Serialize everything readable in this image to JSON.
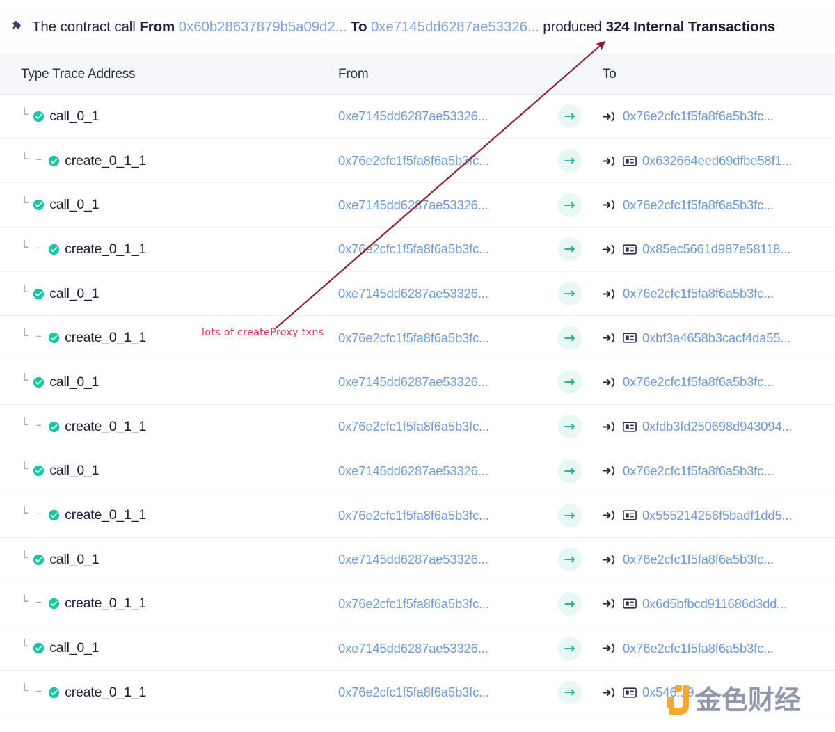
{
  "banner": {
    "icon": "puzzle-piece-icon",
    "prefix": "The contract call",
    "from_label": "From",
    "from_address": "0x60b28637879b5a09d2...",
    "to_label": "To",
    "to_address": "0xe7145dd6287ae53326...",
    "produced_word": "produced",
    "count": "324",
    "suffix": "Internal Transactions"
  },
  "table": {
    "columns": {
      "type": "Type Trace Address",
      "from": "From",
      "to": "To"
    },
    "rows": [
      {
        "level": 1,
        "tree": "└",
        "status": "success-check-icon",
        "type": "call_0_1",
        "from": "0xe7145dd6287ae53326...",
        "arrow": "arrow-right-icon",
        "to_icon": "sign-in-arrow-icon",
        "contract": false,
        "to": "0x76e2cfc1f5fa8f6a5b3fc..."
      },
      {
        "level": 2,
        "tree": "└ –",
        "status": "success-check-icon",
        "type": "create_0_1_1",
        "from": "0x76e2cfc1f5fa8f6a5b3fc...",
        "arrow": "arrow-right-icon",
        "to_icon": "sign-in-arrow-icon",
        "contract": true,
        "to": "0x632664eed69dfbe58f1..."
      },
      {
        "level": 1,
        "tree": "└",
        "status": "success-check-icon",
        "type": "call_0_1",
        "from": "0xe7145dd6287ae53326...",
        "arrow": "arrow-right-icon",
        "to_icon": "sign-in-arrow-icon",
        "contract": false,
        "to": "0x76e2cfc1f5fa8f6a5b3fc..."
      },
      {
        "level": 2,
        "tree": "└ –",
        "status": "success-check-icon",
        "type": "create_0_1_1",
        "from": "0x76e2cfc1f5fa8f6a5b3fc...",
        "arrow": "arrow-right-icon",
        "to_icon": "sign-in-arrow-icon",
        "contract": true,
        "to": "0x85ec5661d987e58118..."
      },
      {
        "level": 1,
        "tree": "└",
        "status": "success-check-icon",
        "type": "call_0_1",
        "from": "0xe7145dd6287ae53326...",
        "arrow": "arrow-right-icon",
        "to_icon": "sign-in-arrow-icon",
        "contract": false,
        "to": "0x76e2cfc1f5fa8f6a5b3fc..."
      },
      {
        "level": 2,
        "tree": "└ –",
        "status": "success-check-icon",
        "type": "create_0_1_1",
        "from": "0x76e2cfc1f5fa8f6a5b3fc...",
        "arrow": "arrow-right-icon",
        "to_icon": "sign-in-arrow-icon",
        "contract": true,
        "to": "0xbf3a4658b3cacf4da55..."
      },
      {
        "level": 1,
        "tree": "└",
        "status": "success-check-icon",
        "type": "call_0_1",
        "from": "0xe7145dd6287ae53326...",
        "arrow": "arrow-right-icon",
        "to_icon": "sign-in-arrow-icon",
        "contract": false,
        "to": "0x76e2cfc1f5fa8f6a5b3fc..."
      },
      {
        "level": 2,
        "tree": "└ –",
        "status": "success-check-icon",
        "type": "create_0_1_1",
        "from": "0x76e2cfc1f5fa8f6a5b3fc...",
        "arrow": "arrow-right-icon",
        "to_icon": "sign-in-arrow-icon",
        "contract": true,
        "to": "0xfdb3fd250698d943094..."
      },
      {
        "level": 1,
        "tree": "└",
        "status": "success-check-icon",
        "type": "call_0_1",
        "from": "0xe7145dd6287ae53326...",
        "arrow": "arrow-right-icon",
        "to_icon": "sign-in-arrow-icon",
        "contract": false,
        "to": "0x76e2cfc1f5fa8f6a5b3fc..."
      },
      {
        "level": 2,
        "tree": "└ –",
        "status": "success-check-icon",
        "type": "create_0_1_1",
        "from": "0x76e2cfc1f5fa8f6a5b3fc...",
        "arrow": "arrow-right-icon",
        "to_icon": "sign-in-arrow-icon",
        "contract": true,
        "to": "0x555214256f5badf1dd5..."
      },
      {
        "level": 1,
        "tree": "└",
        "status": "success-check-icon",
        "type": "call_0_1",
        "from": "0xe7145dd6287ae53326...",
        "arrow": "arrow-right-icon",
        "to_icon": "sign-in-arrow-icon",
        "contract": false,
        "to": "0x76e2cfc1f5fa8f6a5b3fc..."
      },
      {
        "level": 2,
        "tree": "└ –",
        "status": "success-check-icon",
        "type": "create_0_1_1",
        "from": "0x76e2cfc1f5fa8f6a5b3fc...",
        "arrow": "arrow-right-icon",
        "to_icon": "sign-in-arrow-icon",
        "contract": true,
        "to": "0x6d5bfbcd911686d3dd..."
      },
      {
        "level": 1,
        "tree": "└",
        "status": "success-check-icon",
        "type": "call_0_1",
        "from": "0xe7145dd6287ae53326...",
        "arrow": "arrow-right-icon",
        "to_icon": "sign-in-arrow-icon",
        "contract": false,
        "to": "0x76e2cfc1f5fa8f6a5b3fc..."
      },
      {
        "level": 2,
        "tree": "└ –",
        "status": "success-check-icon",
        "type": "create_0_1_1",
        "from": "0x76e2cfc1f5fa8f6a5b3fc...",
        "arrow": "arrow-right-icon",
        "to_icon": "sign-in-arrow-icon",
        "contract": true,
        "to": "0x546...9..."
      }
    ]
  },
  "annotations": {
    "note": "lots of createProxy txns",
    "arrow_color": "#8c1b32"
  },
  "watermark": {
    "text": "金色财经",
    "logo_color": "#f5a623"
  },
  "colors": {
    "link": "#6f9ad2",
    "success": "#16c7a3",
    "header_bg": "#f6f7fa",
    "annotation_red": "#d9365a"
  }
}
